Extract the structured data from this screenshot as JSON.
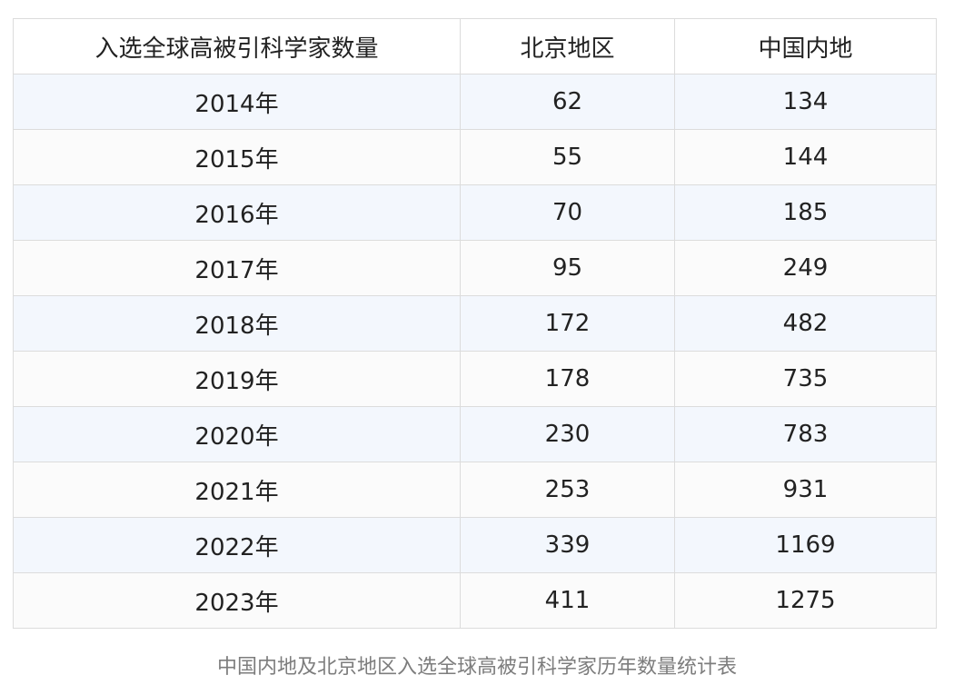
{
  "table": {
    "headers": [
      "入选全球高被引科学家数量",
      "北京地区",
      "中国内地"
    ],
    "rows": [
      [
        "2014年",
        "62",
        "134"
      ],
      [
        "2015年",
        "55",
        "144"
      ],
      [
        "2016年",
        "70",
        "185"
      ],
      [
        "2017年",
        "95",
        "249"
      ],
      [
        "2018年",
        "172",
        "482"
      ],
      [
        "2019年",
        "178",
        "735"
      ],
      [
        "2020年",
        "230",
        "783"
      ],
      [
        "2021年",
        "253",
        "931"
      ],
      [
        "2022年",
        "339",
        "1169"
      ],
      [
        "2023年",
        "411",
        "1275"
      ]
    ]
  },
  "caption": "中国内地及北京地区入选全球高被引科学家历年数量统计表",
  "colors": {
    "row_odd_bg": "#f3f7fd",
    "row_even_bg": "#fbfbfb",
    "border": "#dcdcdc",
    "caption_text": "#7d7d7d"
  }
}
